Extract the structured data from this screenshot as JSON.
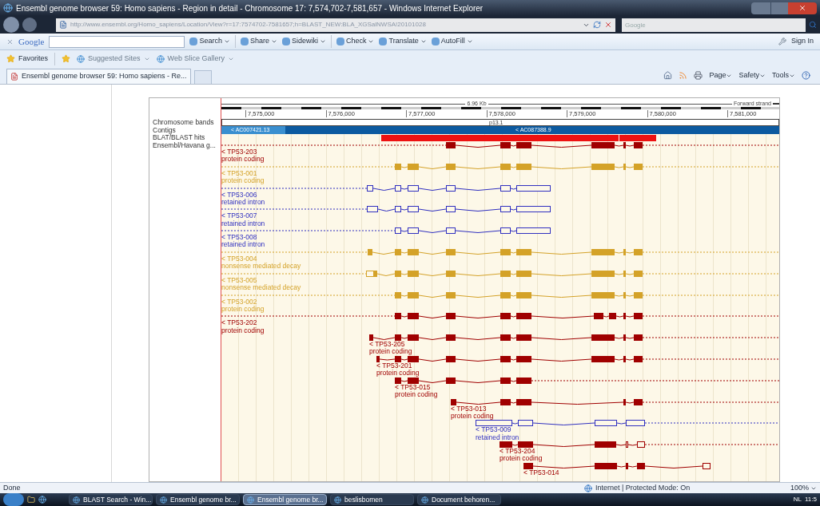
{
  "window": {
    "title": "Ensembl genome browser 59: Homo sapiens - Region in detail - Chromosome 17: 7,574,702-7,581,657 - Windows Internet Explorer"
  },
  "address_bar": {
    "url": "http://www.ensembl.org/Homo_sapiens/Location/View?r=17:7574702-7581657;h=BLAST_NEW:BLA_XGSalNWSA!20101028",
    "search_placeholder": "Google"
  },
  "google_toolbar": {
    "logo": "Google",
    "items": [
      "Search",
      "Share",
      "Sidewiki",
      "Check",
      "Translate",
      "AutoFill"
    ],
    "sign_in": "Sign In"
  },
  "favorites_bar": {
    "label": "Favorites",
    "items": [
      "Suggested Sites",
      "Web Slice Gallery"
    ]
  },
  "tab": {
    "title": "Ensembl genome browser 59: Homo sapiens - Re..."
  },
  "command_bar": [
    "Page",
    "Safety",
    "Tools"
  ],
  "genome_view": {
    "ruler": {
      "length": "6.96 Kb",
      "strand": "Forward strand",
      "ticks": [
        "7,575,000",
        "7,576,000",
        "7,577,000",
        "7,578,000",
        "7,579,000",
        "7,580,000",
        "7,581,000"
      ]
    },
    "track_labels": [
      "Chromosome bands",
      "Contigs",
      "BLAT/BLAST hits",
      "Ensembl/Havana g..."
    ],
    "band": "p13.1",
    "contigs": [
      "< AC007421.13",
      "< AC087388.9"
    ],
    "transcripts": [
      {
        "name": "< TP53-203",
        "biotype": "protein coding",
        "color": "#a00000"
      },
      {
        "name": "< TP53-001",
        "biotype": "protein coding",
        "color": "#d4a228"
      },
      {
        "name": "< TP53-006",
        "biotype": "retained intron",
        "color": "#3030c0"
      },
      {
        "name": "< TP53-007",
        "biotype": "retained intron",
        "color": "#3030c0"
      },
      {
        "name": "< TP53-008",
        "biotype": "retained intron",
        "color": "#3030c0"
      },
      {
        "name": "< TP53-004",
        "biotype": "nonsense mediated decay",
        "color": "#d4a228"
      },
      {
        "name": "< TP53-005",
        "biotype": "nonsense mediated decay",
        "color": "#d4a228"
      },
      {
        "name": "< TP53-002",
        "biotype": "protein coding",
        "color": "#d4a228"
      },
      {
        "name": "< TP53-202",
        "biotype": "protein coding",
        "color": "#a00000"
      },
      {
        "name": "< TP53-205",
        "biotype": "protein coding",
        "color": "#a00000"
      },
      {
        "name": "< TP53-201",
        "biotype": "protein coding",
        "color": "#a00000"
      },
      {
        "name": "< TP53-015",
        "biotype": "protein coding",
        "color": "#a00000"
      },
      {
        "name": "< TP53-013",
        "biotype": "protein coding",
        "color": "#a00000"
      },
      {
        "name": "< TP53-009",
        "biotype": "retained intron",
        "color": "#3030c0"
      },
      {
        "name": "< TP53-204",
        "biotype": "protein coding",
        "color": "#a00000"
      },
      {
        "name": "< TP53-014",
        "color": "#a00000"
      }
    ]
  },
  "status_bar": {
    "text": "Done",
    "zone": "Internet | Protected Mode: On",
    "zoom": "100%"
  },
  "taskbar": {
    "items": [
      {
        "label": "BLAST Search - Win...",
        "selected": false
      },
      {
        "label": "Ensembl genome br...",
        "selected": false
      },
      {
        "label": "Ensembl genome br...",
        "selected": true
      },
      {
        "label": "beslisbomen",
        "selected": false
      },
      {
        "label": "Document behoren...",
        "selected": false
      }
    ],
    "language": "NL",
    "clock": "11:5"
  }
}
